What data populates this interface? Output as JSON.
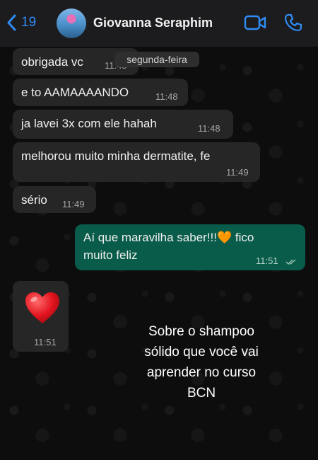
{
  "header": {
    "back_count": "19",
    "contact_name": "Giovanna Seraphim"
  },
  "date_chip": "segunda-feira",
  "messages": [
    {
      "direction": "incoming",
      "text": "obrigada vc",
      "time": "11:48"
    },
    {
      "direction": "incoming",
      "text": "e to AAMAAAANDO",
      "time": "11:48"
    },
    {
      "direction": "incoming",
      "text": "ja lavei 3x com ele hahah",
      "time": "11:48"
    },
    {
      "direction": "incoming",
      "text": "melhorou muito minha dermatite, fe",
      "time": "11:49"
    },
    {
      "direction": "incoming",
      "text": "sério",
      "time": "11:49"
    },
    {
      "direction": "outgoing",
      "text_line1": "Aí que maravilha saber!!!🧡 fico",
      "text_line2": "muito feliz",
      "time": "11:51",
      "status": "read"
    },
    {
      "direction": "incoming",
      "emoji": "red-heart",
      "time": "11:51"
    }
  ],
  "caption": "Sobre o shampoo\nsólido que você vai\naprender no curso\nBCN",
  "colors": {
    "accent": "#2f8cf5",
    "incoming_bubble": "#262626",
    "outgoing_bubble": "#0a5c4a",
    "header": "#1c1c1e"
  }
}
